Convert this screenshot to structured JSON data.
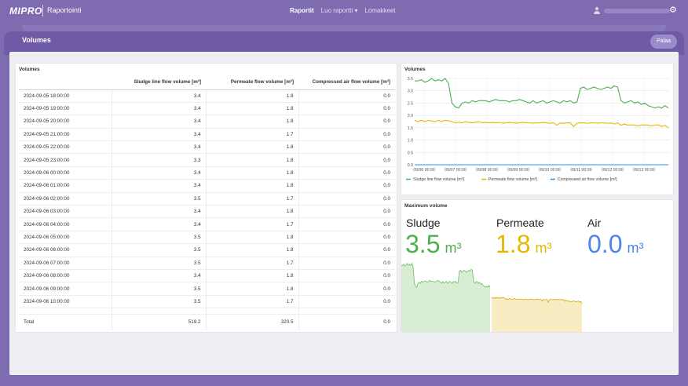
{
  "header": {
    "brand": "MIPRO",
    "app_title": "Raportointi",
    "nav": [
      "Raportit",
      "Luo raportti",
      "Lomakkeet"
    ]
  },
  "page": {
    "tab": "Volumes",
    "back_button": "Palaa"
  },
  "table": {
    "title": "Volumes",
    "columns": [
      "",
      "Sludge line flow volume [m³]",
      "Permeate flow volume [m³]",
      "Compressed air flow volume [m³]"
    ],
    "rows": [
      [
        "2024-09-05 18:00:00",
        "3.4",
        "1.8",
        "0.0"
      ],
      [
        "2024-09-05 19:00:00",
        "3.4",
        "1.8",
        "0.0"
      ],
      [
        "2024-09-05 20:00:00",
        "3.4",
        "1.8",
        "0.0"
      ],
      [
        "2024-09-05 21:00:00",
        "3.4",
        "1.7",
        "0.0"
      ],
      [
        "2024-09-05 22:00:00",
        "3.4",
        "1.8",
        "0.0"
      ],
      [
        "2024-09-05 23:00:00",
        "3.3",
        "1.8",
        "0.0"
      ],
      [
        "2024-09-06 00:00:00",
        "3.4",
        "1.8",
        "0.0"
      ],
      [
        "2024-09-06 01:00:00",
        "3.4",
        "1.8",
        "0.0"
      ],
      [
        "2024-09-06 02:00:00",
        "3.5",
        "1.7",
        "0.0"
      ],
      [
        "2024-09-06 03:00:00",
        "3.4",
        "1.8",
        "0.0"
      ],
      [
        "2024-09-06 04:00:00",
        "3.4",
        "1.7",
        "0.0"
      ],
      [
        "2024-09-06 05:00:00",
        "3.5",
        "1.8",
        "0.0"
      ],
      [
        "2024-09-06 06:00:00",
        "3.5",
        "1.8",
        "0.0"
      ],
      [
        "2024-09-06 07:00:00",
        "3.5",
        "1.7",
        "0.0"
      ],
      [
        "2024-09-06 08:00:00",
        "3.4",
        "1.8",
        "0.0"
      ],
      [
        "2024-09-06 09:00:00",
        "3.5",
        "1.8",
        "0.0"
      ],
      [
        "2024-09-06 10:00:00",
        "3.5",
        "1.7",
        "0.0"
      ]
    ],
    "total": [
      "Total",
      "519.2",
      "320.5",
      "0.0"
    ]
  },
  "chart_data": {
    "type": "line",
    "title": "Volumes",
    "ylim": [
      0,
      3.5
    ],
    "yticks": [
      "0.0",
      "0.5",
      "1.0",
      "1.5",
      "2.0",
      "2.5",
      "3.0",
      "3.5"
    ],
    "x_labels": [
      "09/06 00:00",
      "09/07 00:00",
      "09/08 00:00",
      "09/09 00:00",
      "09/10 00:00",
      "09/11 00:00",
      "09/12 00:00",
      "09/13 00:00"
    ],
    "grid": true,
    "legend": "bottom",
    "series": [
      {
        "name": "Sludge line flow volume [m³]",
        "color": "#4caf50",
        "values": [
          3.4,
          3.4,
          3.45,
          3.35,
          3.4,
          3.5,
          3.4,
          3.45,
          3.4,
          3.5,
          3.3,
          2.5,
          2.35,
          2.3,
          2.5,
          2.55,
          2.5,
          2.6,
          2.55,
          2.6,
          2.6,
          2.6,
          2.55,
          2.6,
          2.65,
          2.6,
          2.6,
          2.6,
          2.55,
          2.6,
          2.6,
          2.65,
          2.6,
          2.55,
          2.5,
          2.6,
          2.5,
          2.55,
          2.6,
          2.5,
          2.55,
          2.6,
          2.55,
          2.5,
          2.6,
          2.55,
          2.6,
          2.5,
          2.55,
          3.1,
          3.15,
          3.05,
          3.1,
          3.15,
          3.1,
          3.05,
          3.1,
          3.15,
          3.1,
          3.2,
          3.15,
          2.6,
          2.5,
          2.55,
          2.6,
          2.5,
          2.55,
          2.45,
          2.5,
          2.4,
          2.35,
          2.3,
          2.35,
          2.3,
          2.4,
          2.3
        ]
      },
      {
        "name": "Permeate flow volume [m³]",
        "color": "#e6b800",
        "values": [
          1.8,
          1.75,
          1.8,
          1.75,
          1.8,
          1.78,
          1.75,
          1.8,
          1.75,
          1.8,
          1.78,
          1.75,
          1.7,
          1.72,
          1.7,
          1.75,
          1.72,
          1.7,
          1.72,
          1.75,
          1.7,
          1.72,
          1.7,
          1.72,
          1.7,
          1.72,
          1.68,
          1.7,
          1.72,
          1.7,
          1.68,
          1.7,
          1.72,
          1.7,
          1.7,
          1.68,
          1.7,
          1.7,
          1.72,
          1.7,
          1.68,
          1.7,
          1.6,
          1.7,
          1.68,
          1.7,
          1.7,
          1.55,
          1.68,
          1.7,
          1.7,
          1.68,
          1.7,
          1.7,
          1.68,
          1.7,
          1.7,
          1.68,
          1.7,
          1.65,
          1.7,
          1.6,
          1.65,
          1.6,
          1.62,
          1.6,
          1.58,
          1.6,
          1.62,
          1.6,
          1.58,
          1.6,
          1.62,
          1.55,
          1.6,
          1.5
        ]
      },
      {
        "name": "Compressed air flow volume [m³]",
        "color": "#2196f3",
        "values": [
          0.0,
          0.0
        ]
      }
    ]
  },
  "max_volume": {
    "title": "Maximum volume",
    "metrics": [
      {
        "label": "Sludge",
        "value": "3.5",
        "unit": "m³",
        "color": "#4caf50"
      },
      {
        "label": "Permeate",
        "value": "1.8",
        "unit": "m³",
        "color": "#e6b800"
      },
      {
        "label": "Air",
        "value": "0.0",
        "unit": "m³",
        "color": "#4a86e8"
      }
    ]
  }
}
